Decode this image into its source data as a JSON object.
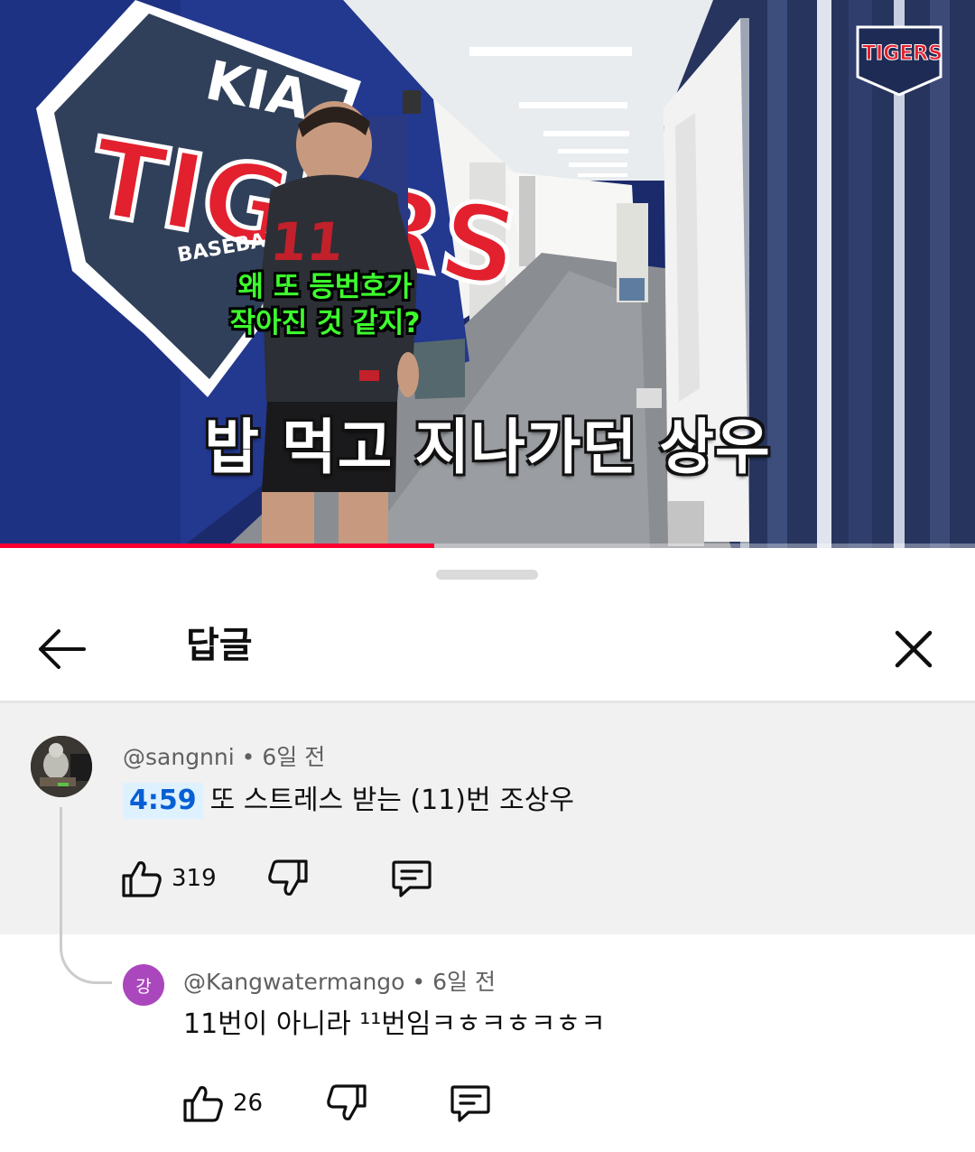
{
  "video": {
    "caption_small_line1": "왜 또 등번호가",
    "caption_small_line2": "작아진 것 같지?",
    "caption_big": "밥 먹고 지나가던 상우",
    "wall_logo_text": "TIGERS",
    "wall_logo_sub": "BASEBALL CLUB",
    "wall_logo_brand": "KIA",
    "jersey_number": "11",
    "channel_logo_text": "TIGERS",
    "progress": 0.445,
    "progress_color": "#ff0033"
  },
  "sheet": {
    "title": "답글",
    "back_icon": "arrow-left-icon",
    "close_icon": "close-icon"
  },
  "parent_comment": {
    "author": "@sangnni",
    "separator": "•",
    "time": "6일 전",
    "timestamp_link": "4:59",
    "text": "또 스트레스 받는 (11)번 조상우",
    "likes": "319"
  },
  "reply": {
    "avatar_letter": "강",
    "avatar_color": "#ab47bc",
    "author": "@Kangwatermango",
    "separator": "•",
    "time": "6일 전",
    "text": "11번이 아니라 ¹¹번임ㅋㅎㅋㅎㅋㅎㅋ",
    "likes": "26"
  },
  "colors": {
    "timestamp_link": "#065fd4",
    "timestamp_bg": "#def1ff",
    "parent_bg": "#f1f1f1"
  }
}
